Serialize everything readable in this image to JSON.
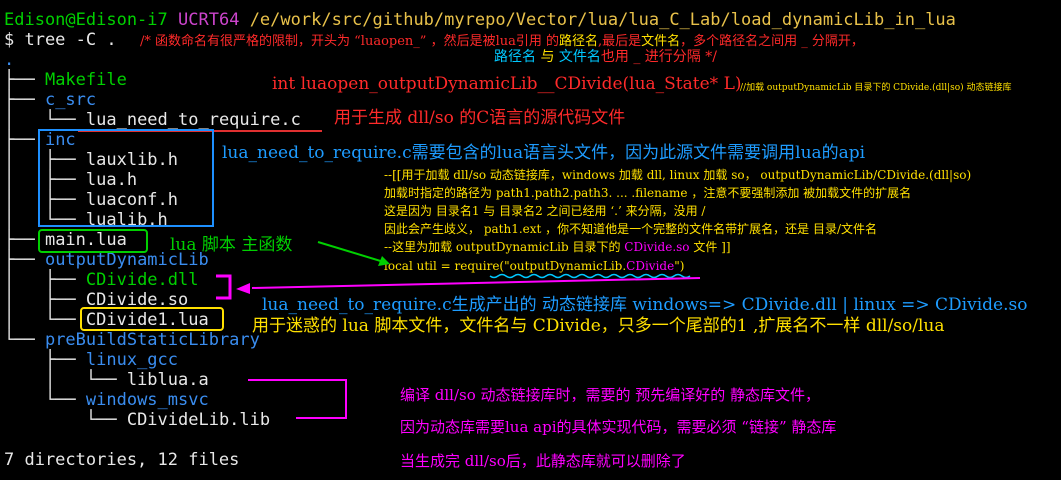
{
  "terminal": {
    "user_host": "Edison@Edison-i7",
    "env": "UCRT64",
    "cwd": "/e/work/src/github/myrepo/Vector/lua/lua_C_Lab/load_dynamicLib_in_lua",
    "command": "$ tree -C ."
  },
  "tree": {
    "root": ".",
    "makefile": "Makefile",
    "c_src": "c_src",
    "lua_need_to_require_c": "lua_need_to_require.c",
    "inc": "inc",
    "lauxlib_h": "lauxlib.h",
    "lua_h": "lua.h",
    "luaconf_h": "luaconf.h",
    "lualib_h": "lualib.h",
    "main_lua": "main.lua",
    "output_dir": "outputDynamicLib",
    "cdivide_dll": "CDivide.dll",
    "cdivide_so": "CDivide.so",
    "cdivide1_lua": "CDivide1.lua",
    "prebuild_dir": "preBuildStaticLibrary",
    "linux_gcc": "linux_gcc",
    "liblua_a": "liblua.a",
    "windows_msvc": "windows_msvc",
    "cdividelib_lib": "CDivideLib.lib",
    "summary": "7 directories, 12 files"
  },
  "annotations": {
    "header_note_a": "/* 函数命名有很严格的限制，开头为 “luaopen_” ，然后是被lua引用 的",
    "header_note_path": "路径名",
    "header_note_b": ",最后是",
    "header_note_file": "文件名",
    "header_note_c": "，多个路径名之间用 _ 分隔开，",
    "header2_path": "路径名",
    "header2_and": " 与 ",
    "header2_file": "文件名",
    "header2_rest": "也用 _ 进行分隔   */",
    "func_sig": "int luaopen_outputDynamicLib__CDivide(lua_State* L)",
    "func_comment": "//加载  outputDynamicLib 目录下的 CDivide.(dll|so) 动态链接库",
    "c_source_note": "用于生成 dll/so 的C语言的源代码文件",
    "inc_note": "lua_need_to_require.c需要包含的lua语言头文件，因为此源文件需要调用lua的api",
    "cpath_1": "--[[用于加载 dll/so 动态链接库，windows 加载 dll, linux 加载 so， outputDynamicLib/CDivide.(dll|so)",
    "cpath_2": "加载时指定的路径为 path1.path2.path3. ... .filename ，注意不要强制添加 被加载文件的扩展名",
    "cpath_3": "这是因为  目录名1 与 目录名2 之间已经用 ‘.’ 来分隔，没用 /",
    "cpath_4": "因此会产生歧义，   path1.ext  ，你不知道他是一个完整的文件名带扩展名，还是 目录/文件名",
    "cpath_5a": "--这里为加载 outputDynamicLib 目录下的 ",
    "cpath_5b": "CDivide.so",
    "cpath_5c": "  文件  ]]",
    "require_a": "local util = require(\"",
    "require_b": "outputDynamicLib.",
    "require_c": "CDivide",
    "require_d": "\")",
    "main_note": "lua 脚本 主函数",
    "dyn_note": "lua_need_to_require.c生成产出的 动态链接库 windows=> CDivide.dll  | linux => CDivide.so",
    "confuse_note": "用于迷惑的 lua 脚本文件，文件名与  CDivide，只多一个尾部的1 ,扩展名不一样 dll/so/lua",
    "static_1": "编译 dll/so 动态链接库时，需要的 预先编译好的 静态库文件，",
    "static_2": "因为动态库需要lua api的具体实现代码，需要必须 “链接” 静态库",
    "static_3": "当生成完 dll/so后，此静态库就可以删除了"
  },
  "colors": {
    "background": "#000000",
    "directory": "#3a8df0",
    "prompt_green": "#00d000",
    "red": "#e03030",
    "yellow": "#ffe000",
    "magenta": "#ff00ff",
    "cyan": "#00c8ff",
    "blue_box": "#1e90ff"
  }
}
